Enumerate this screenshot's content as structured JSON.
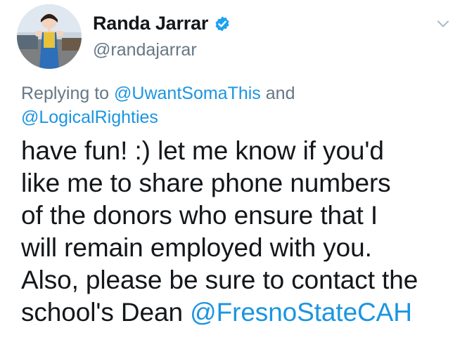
{
  "author": {
    "display_name": "Randa Jarrar",
    "handle": "@randajarrar",
    "verified": true
  },
  "icons": {
    "verified": "verified-badge-icon",
    "menu": "chevron-down-icon"
  },
  "reply_context": {
    "prefix": "Replying to ",
    "mention_1": "@UwantSomaThis",
    "joiner": " and",
    "mention_2": "@LogicalRighties"
  },
  "tweet": {
    "lines": [
      "have fun! :) let me know if you'd",
      "like me to share phone numbers",
      "of the donors who ensure that I",
      "will remain employed with you.",
      "Also, please be sure to contact the"
    ],
    "last_line_text": "school's Dean ",
    "last_line_mention": "@FresnoStateCAH"
  },
  "colors": {
    "link": "#1b95e0",
    "secondary_text": "#657786",
    "primary_text": "#14171a",
    "verified_badge": "#1da1f2"
  }
}
